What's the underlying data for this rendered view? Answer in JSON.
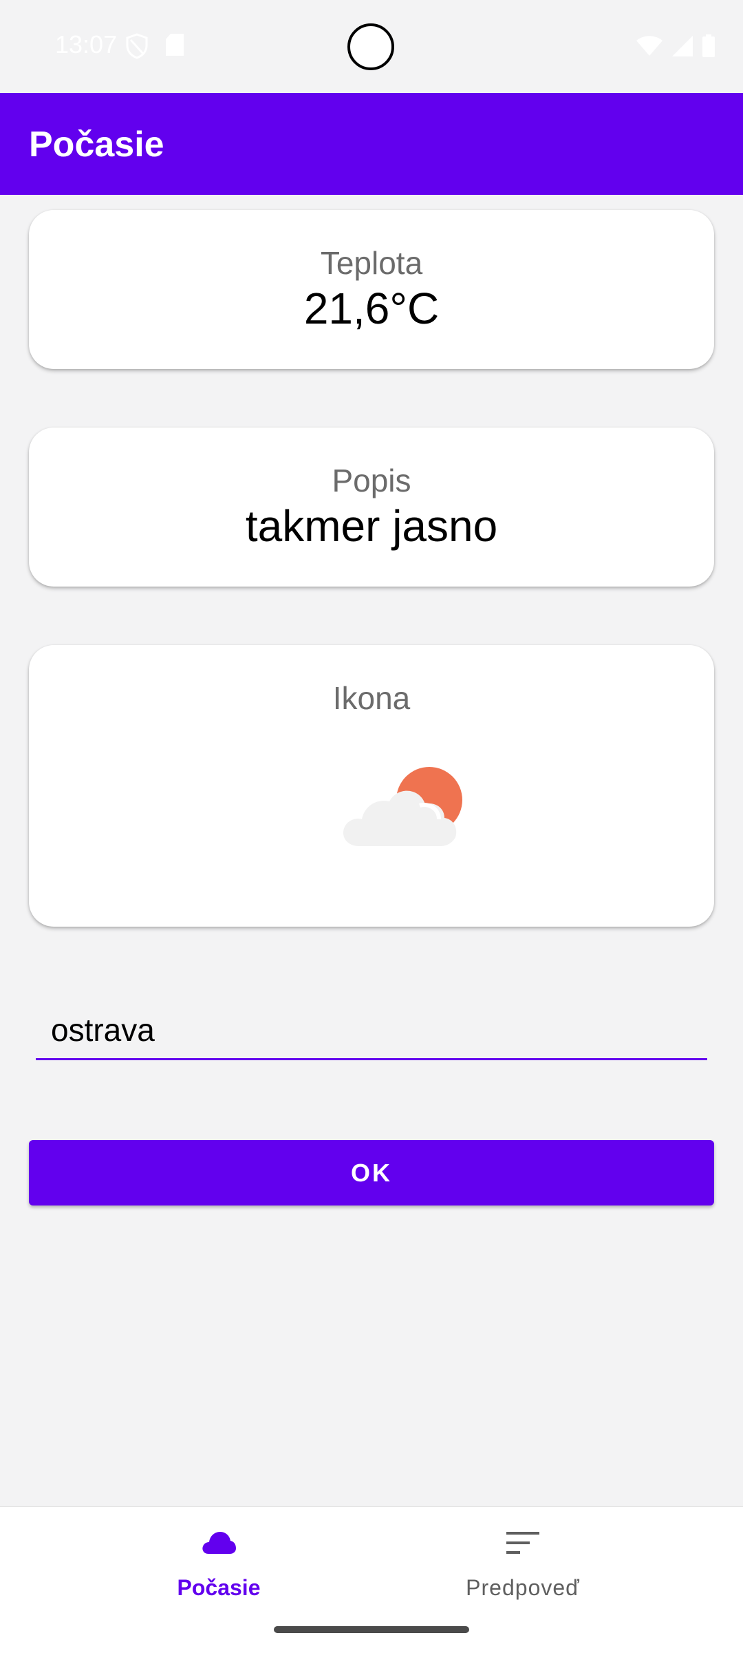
{
  "status_bar": {
    "time": "13:07",
    "icons": [
      "shield-icon",
      "sd-card-icon",
      "wifi-icon",
      "signal-icon",
      "battery-icon"
    ]
  },
  "app_bar": {
    "title": "Počasie",
    "color": "#6200ee"
  },
  "cards": {
    "temperature": {
      "label": "Teplota",
      "value": "21,6°C"
    },
    "description": {
      "label": "Popis",
      "value": "takmer jasno"
    },
    "icon": {
      "label": "Ikona",
      "icon_name": "partly-cloudy-icon"
    }
  },
  "city_input": {
    "value": "ostrava"
  },
  "ok_button": {
    "label": "OK"
  },
  "bottom_nav": {
    "items": [
      {
        "label": "Počasie",
        "icon": "cloud-icon",
        "active": true
      },
      {
        "label": "Predpoveď",
        "icon": "sort-lines-icon",
        "active": false
      }
    ]
  },
  "colors": {
    "primary": "#6200ee",
    "background": "#f3f3f4",
    "sun": "#ef7350",
    "cloud": "#f1f1f1"
  }
}
